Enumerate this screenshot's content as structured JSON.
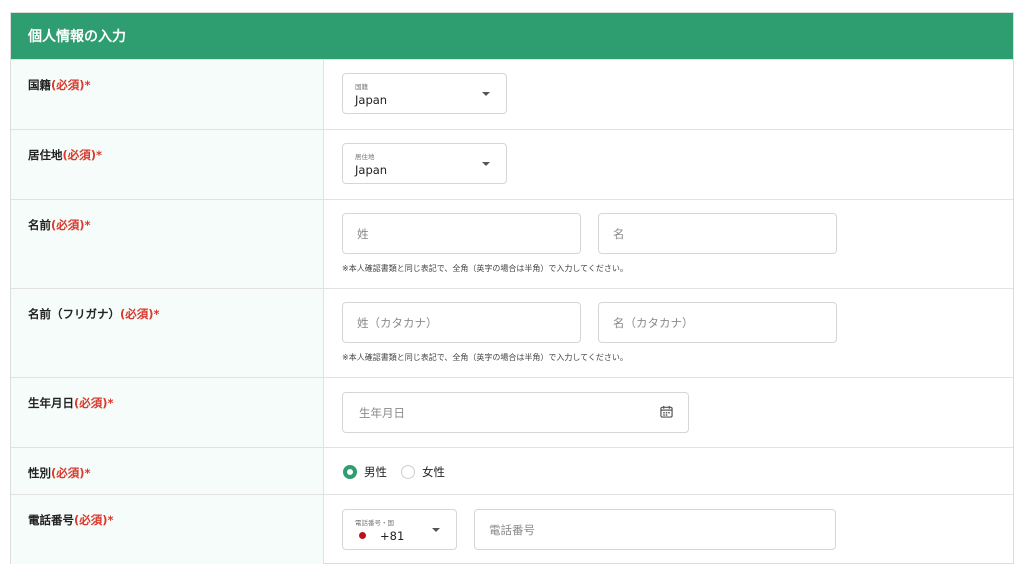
{
  "header": {
    "title": "個人情報の入力"
  },
  "required_mark": "(必須)*",
  "fields": {
    "nationality": {
      "label": "国籍",
      "small_label": "国籍",
      "value": "Japan"
    },
    "residence": {
      "label": "居住地",
      "small_label": "居住地",
      "value": "Japan"
    },
    "name": {
      "label": "名前",
      "last_placeholder": "姓",
      "first_placeholder": "名",
      "note": "※本人確認書類と同じ表記で、全角（英字の場合は半角）で入力してください。"
    },
    "name_kana": {
      "label": "名前（フリガナ）",
      "last_placeholder": "姓（カタカナ）",
      "first_placeholder": "名（カタカナ）",
      "note": "※本人確認書類と同じ表記で、全角（英字の場合は半角）で入力してください。"
    },
    "birthdate": {
      "label": "生年月日",
      "placeholder": "生年月日"
    },
    "gender": {
      "label": "性別",
      "options": [
        "男性",
        "女性"
      ],
      "selected": "男性"
    },
    "phone": {
      "label": "電話番号",
      "code_small_label": "電話番号・国",
      "code_value": "+81",
      "placeholder": "電話番号"
    }
  },
  "colors": {
    "accent": "#2e9d70",
    "required": "#d9392c",
    "label_bg": "#f5fcfa"
  },
  "icons": [
    "caret-down-icon",
    "calendar-icon",
    "japan-flag-icon"
  ]
}
